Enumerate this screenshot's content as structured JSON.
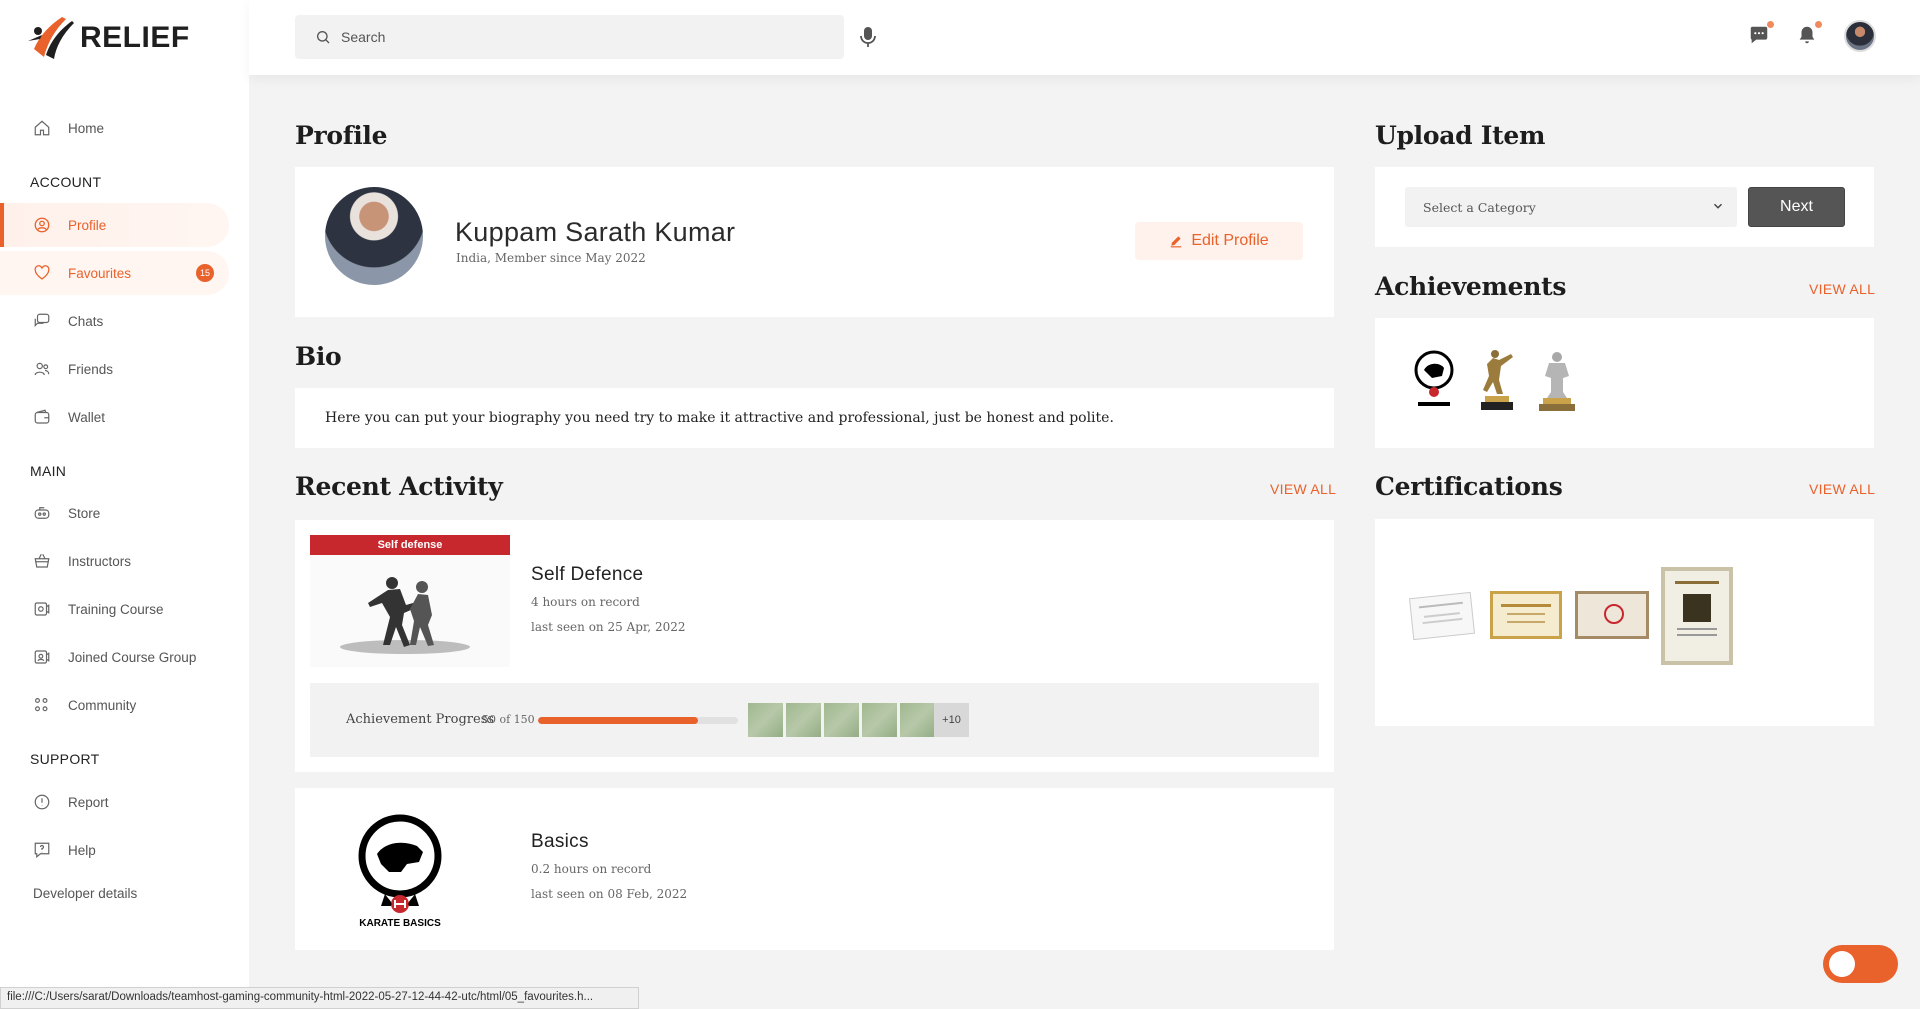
{
  "brand": {
    "name": "RELIEF"
  },
  "sidebar": {
    "home": "Home",
    "account_heading": "ACCOUNT",
    "account_items": [
      {
        "label": "Profile",
        "icon": "user-circle-icon"
      },
      {
        "label": "Favourites",
        "icon": "heart-icon",
        "badge": "15"
      },
      {
        "label": "Chats",
        "icon": "chat-icon"
      },
      {
        "label": "Friends",
        "icon": "friends-icon"
      },
      {
        "label": "Wallet",
        "icon": "wallet-icon"
      }
    ],
    "main_heading": "MAIN",
    "main_items": [
      {
        "label": "Store",
        "icon": "store-icon"
      },
      {
        "label": "Instructors",
        "icon": "basket-icon"
      },
      {
        "label": "Training Course",
        "icon": "course-icon"
      },
      {
        "label": "Joined Course Group",
        "icon": "group-icon"
      },
      {
        "label": "Community",
        "icon": "community-icon"
      }
    ],
    "support_heading": "SUPPORT",
    "support_items": [
      {
        "label": "Report",
        "icon": "alert-icon"
      },
      {
        "label": "Help",
        "icon": "help-icon"
      }
    ],
    "developer": "Developer details"
  },
  "topbar": {
    "search_placeholder": "Search"
  },
  "profile": {
    "heading": "Profile",
    "name": "Kuppam Sarath Kumar",
    "subtitle": "India, Member since May 2022",
    "edit_label": "Edit Profile"
  },
  "bio": {
    "heading": "Bio",
    "text": "Here you can put your biography you need try to make it attractive and professional, just be honest and polite."
  },
  "activity": {
    "heading": "Recent Activity",
    "view_all": "VIEW ALL",
    "items": [
      {
        "thumb_label": "Self defense",
        "title": "Self Defence",
        "hours": "4 hours on record",
        "last_seen": "last seen on 25 Apr, 2022",
        "progress_label": "Achievement Progress",
        "progress_text": "50 of 150",
        "progress_fraction": 0.8,
        "more": "+10"
      },
      {
        "logo_label": "KARATE BASICS",
        "title": "Basics",
        "hours": "0.2 hours on record",
        "last_seen": "last seen on 08 Feb, 2022"
      }
    ]
  },
  "upload": {
    "heading": "Upload Item",
    "select_value": "Select a Category",
    "next_label": "Next"
  },
  "achievements": {
    "heading": "Achievements",
    "view_all": "VIEW ALL"
  },
  "certifications": {
    "heading": "Certifications",
    "view_all": "VIEW ALL"
  },
  "status_bar": "file:///C:/Users/sarat/Downloads/teamhost-gaming-community-html-2022-05-27-12-44-42-utc/html/05_favourites.h...",
  "colors": {
    "accent": "#e9612b",
    "dark_button": "#555555"
  }
}
